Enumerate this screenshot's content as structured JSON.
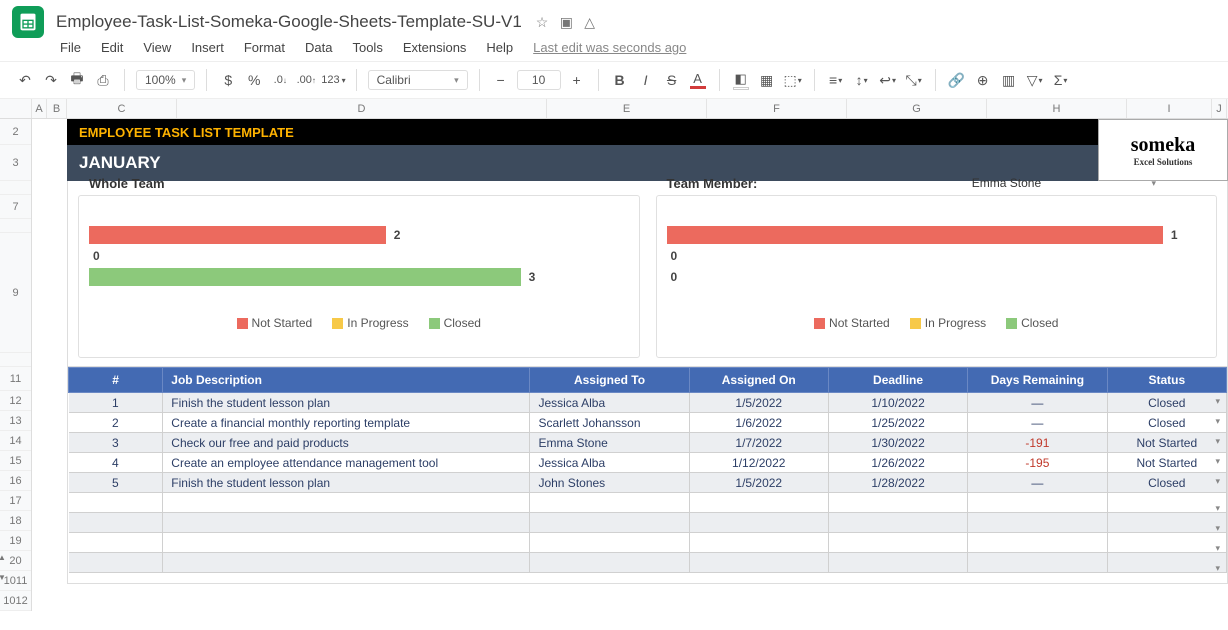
{
  "app": {
    "title": "Employee-Task-List-Someka-Google-Sheets-Template-SU-V1"
  },
  "menus": [
    "File",
    "Edit",
    "View",
    "Insert",
    "Format",
    "Data",
    "Tools",
    "Extensions",
    "Help"
  ],
  "last_edit": "Last edit was seconds ago",
  "toolbar": {
    "zoom": "100%",
    "currency": "$",
    "percent": "%",
    "dec_dec": ".0",
    "inc_dec": ".00",
    "numfmt": "123",
    "font": "Calibri",
    "size": "10"
  },
  "col_headers": [
    "A",
    "B",
    "C",
    "D",
    "E",
    "F",
    "G",
    "H",
    "I",
    "J"
  ],
  "row_headers": [
    "2",
    "3",
    "",
    "7",
    "",
    "9",
    "",
    "11",
    "12",
    "13",
    "14",
    "15",
    "16",
    "17",
    "18",
    "19",
    "20",
    "1011",
    "1012"
  ],
  "template": {
    "title": "EMPLOYEE TASK LIST TEMPLATE",
    "month": "JANUARY",
    "logo": {
      "l1": "someka",
      "l2": "Excel Solutions"
    }
  },
  "chart_data": [
    {
      "type": "bar",
      "title": "Whole Team",
      "categories": [
        "Not Started",
        "In Progress",
        "Closed"
      ],
      "values": [
        2,
        0,
        3
      ],
      "colors": [
        "#ec6a5e",
        "#f7c948",
        "#8cc97b"
      ],
      "xlabel": "",
      "ylabel": "",
      "xlim": [
        0,
        3
      ]
    },
    {
      "type": "bar",
      "title": "Team Member:",
      "member": "Emma Stone",
      "categories": [
        "Not Started",
        "In Progress",
        "Closed"
      ],
      "values": [
        1,
        0,
        0
      ],
      "colors": [
        "#ec6a5e",
        "#f7c948",
        "#8cc97b"
      ],
      "xlabel": "",
      "ylabel": "",
      "xlim": [
        0,
        1
      ]
    }
  ],
  "legend": [
    "Not Started",
    "In Progress",
    "Closed"
  ],
  "table": {
    "headers": [
      "#",
      "Job Description",
      "Assigned To",
      "Assigned On",
      "Deadline",
      "Days Remaining",
      "Status"
    ],
    "rows": [
      {
        "n": "1",
        "job": "Finish the student lesson plan",
        "who": "Jessica Alba",
        "aon": "1/5/2022",
        "dead": "1/10/2022",
        "days": "—",
        "status": "Closed",
        "days_red": false
      },
      {
        "n": "2",
        "job": "Create a financial monthly reporting template",
        "who": "Scarlett Johansson",
        "aon": "1/6/2022",
        "dead": "1/25/2022",
        "days": "—",
        "status": "Closed",
        "days_red": false
      },
      {
        "n": "3",
        "job": "Check our free and paid products",
        "who": "Emma Stone",
        "aon": "1/7/2022",
        "dead": "1/30/2022",
        "days": "-191",
        "status": "Not Started",
        "days_red": true
      },
      {
        "n": "4",
        "job": "Create an employee attendance management tool",
        "who": "Jessica Alba",
        "aon": "1/12/2022",
        "dead": "1/26/2022",
        "days": "-195",
        "status": "Not Started",
        "days_red": true
      },
      {
        "n": "5",
        "job": "Finish the student lesson plan",
        "who": "John Stones",
        "aon": "1/5/2022",
        "dead": "1/28/2022",
        "days": "—",
        "status": "Closed",
        "days_red": false
      },
      {
        "n": "",
        "job": "",
        "who": "",
        "aon": "",
        "dead": "",
        "days": "",
        "status": ""
      },
      {
        "n": "",
        "job": "",
        "who": "",
        "aon": "",
        "dead": "",
        "days": "",
        "status": ""
      },
      {
        "n": "",
        "job": "",
        "who": "",
        "aon": "",
        "dead": "",
        "days": "",
        "status": ""
      },
      {
        "n": "",
        "job": "",
        "who": "",
        "aon": "",
        "dead": "",
        "days": "",
        "status": ""
      }
    ]
  }
}
